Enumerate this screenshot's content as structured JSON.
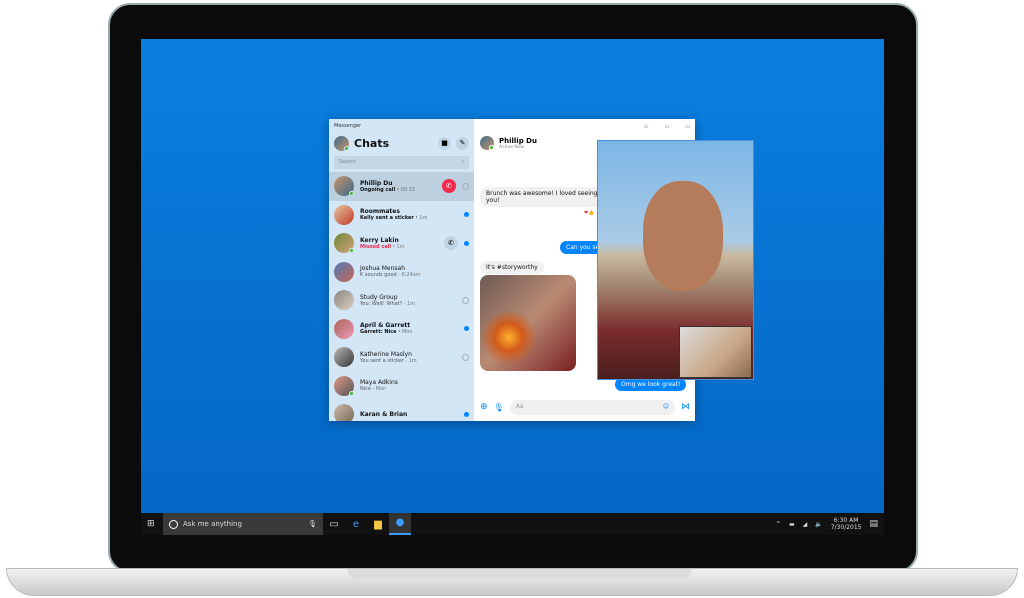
{
  "messenger": {
    "app_title": "Messenger",
    "header": "Chats",
    "search_placeholder": "Search",
    "chats": [
      {
        "name": "Phillip Du",
        "preview": "Ongoing call",
        "time": "00:33",
        "unread": true,
        "status": "ongoing"
      },
      {
        "name": "Roommates",
        "preview": "Kelly sent a sticker",
        "time": "1m",
        "unread": true,
        "status": "unread"
      },
      {
        "name": "Kerry Lakin",
        "preview": "Missed call",
        "time": "1m",
        "unread": true,
        "status": "missed"
      },
      {
        "name": "Joshua Mensah",
        "preview": "K sounds good",
        "time": "8:24am",
        "unread": false,
        "status": "read"
      },
      {
        "name": "Study Group",
        "preview": "You: Wait! What?",
        "time": "1m",
        "unread": false,
        "status": "sent"
      },
      {
        "name": "April & Garrett",
        "preview": "Garrett: Nice",
        "time": "Mon",
        "unread": true,
        "status": "unread"
      },
      {
        "name": "Katherine Maslyn",
        "preview": "You sent a sticker",
        "time": "1m",
        "unread": false,
        "status": "sent"
      },
      {
        "name": "Maya Adkins",
        "preview": "Nice",
        "time": "Mon",
        "unread": false,
        "status": "read"
      },
      {
        "name": "Karan & Brian",
        "preview": "",
        "time": "",
        "unread": true,
        "status": "unread"
      }
    ],
    "conversation": {
      "name": "Phillip Du",
      "status": "Active Now",
      "messages": [
        {
          "from": "them",
          "text": "Brunch was awesome! I loved seeing you!"
        },
        {
          "from": "me",
          "text": "Can you send"
        },
        {
          "from": "them",
          "text": "It's #storyworthy"
        },
        {
          "from": "me",
          "text": "Omg we look great!"
        }
      ],
      "reactions": "❤👍",
      "input_placeholder": "Aa"
    }
  },
  "taskbar": {
    "search_placeholder": "Ask me anything",
    "time": "6:30 AM",
    "date": "7/30/2015"
  },
  "colors": {
    "accent": "#0084ff",
    "end_call": "#f0284a",
    "desktop": "#0a7fe0"
  }
}
